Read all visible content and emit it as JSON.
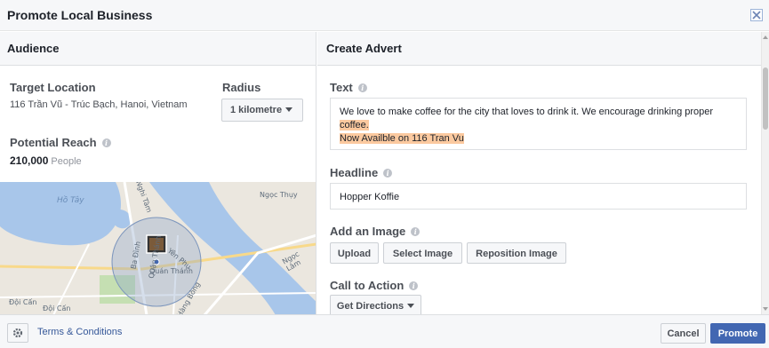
{
  "dialog": {
    "title": "Promote Local Business",
    "close_icon": "close-icon"
  },
  "audience": {
    "heading": "Audience",
    "target_location_label": "Target Location",
    "target_location_value": "116 Trần Vũ - Trúc Bạch, Hanoi, Vietnam",
    "radius_label": "Radius",
    "radius_value": "1 kilometre",
    "potential_reach_label": "Potential Reach",
    "potential_reach_value": "210,000",
    "potential_reach_unit": "People",
    "map": {
      "labels": [
        "Hồ Tây",
        "Nghi Tàm",
        "Yên Phụ",
        "Quán Thánh",
        "Đội Cấn",
        "Đội Cấn",
        "Hàng Bông",
        "Ngọc Lâm",
        "Ngọc Thụy",
        "Ba Đình",
        "Quận Thánh"
      ]
    }
  },
  "advert": {
    "heading": "Create Advert",
    "text_label": "Text",
    "text_line1": "We love to make coffee for the city that loves to drink it. We encourage drinking proper",
    "text_line2": "coffee.",
    "text_line3": "Now Availble on 116 Tran Vu",
    "headline_label": "Headline",
    "headline_value": "Hopper Koffie",
    "image_label": "Add an Image",
    "upload_button": "Upload",
    "select_image_button": "Select Image",
    "reposition_button": "Reposition Image",
    "cta_label": "Call to Action",
    "cta_value": "Get Directions"
  },
  "footer": {
    "settings_icon": "gear-icon",
    "terms_link": "Terms & Conditions",
    "cancel_button": "Cancel",
    "promote_button": "Promote"
  },
  "colors": {
    "primary": "#4267b2",
    "link": "#365899",
    "highlight": "#fbc99f",
    "water": "#6fa8dc",
    "radius_circle": "#8aa4c8"
  }
}
